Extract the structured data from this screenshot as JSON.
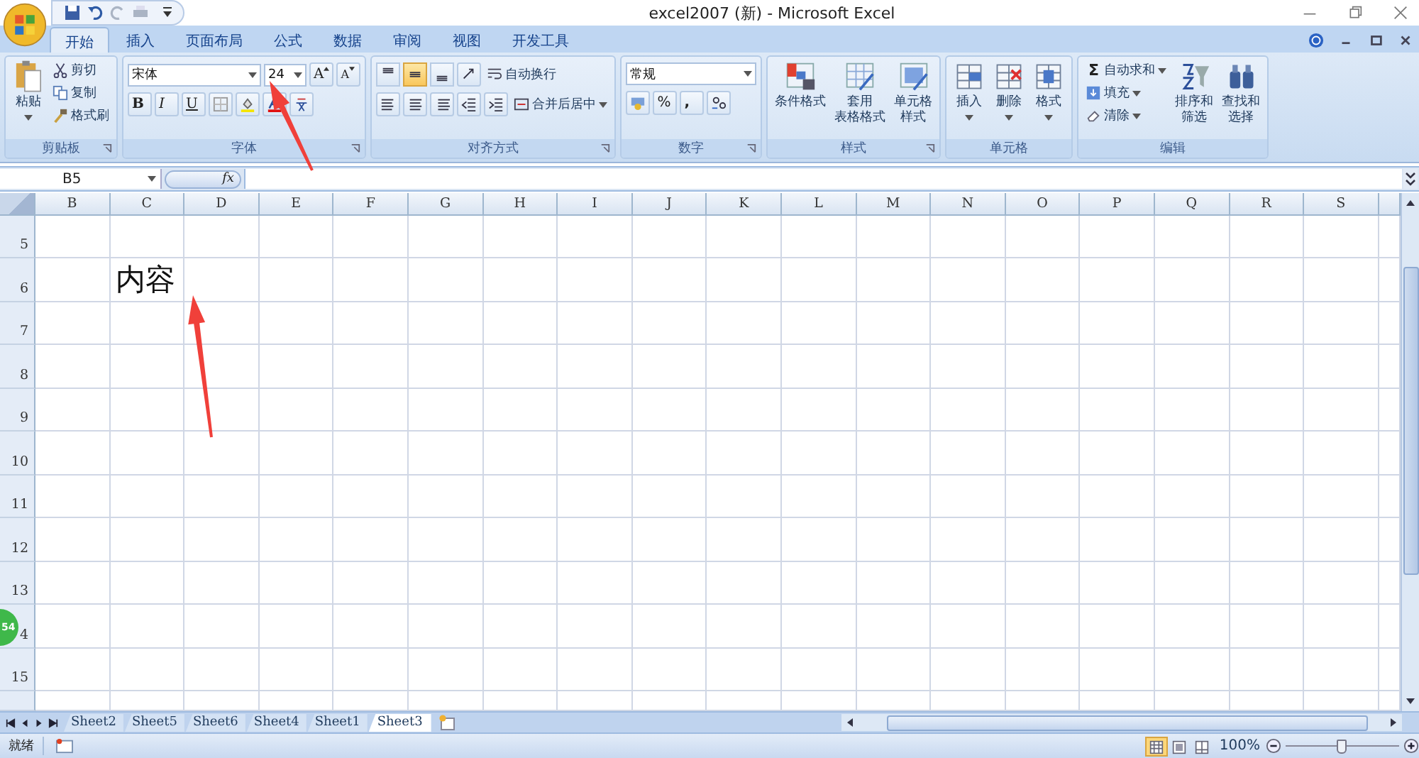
{
  "window": {
    "title": "excel2007 (新) - Microsoft Excel"
  },
  "tabs": [
    {
      "label": "开始",
      "selected": true
    },
    {
      "label": "插入",
      "selected": false
    },
    {
      "label": "页面布局",
      "selected": false
    },
    {
      "label": "公式",
      "selected": false
    },
    {
      "label": "数据",
      "selected": false
    },
    {
      "label": "审阅",
      "selected": false
    },
    {
      "label": "视图",
      "selected": false
    },
    {
      "label": "开发工具",
      "selected": false
    }
  ],
  "ribbon": {
    "clipboard": {
      "label": "剪贴板",
      "paste": "粘贴",
      "items": [
        "剪切",
        "复制",
        "格式刷"
      ]
    },
    "font": {
      "label": "字体",
      "font_name": "宋体",
      "font_size": "24",
      "grow": "A",
      "shrink": "A",
      "bold": "B",
      "italic": "I",
      "underline": "U"
    },
    "alignment": {
      "label": "对齐方式",
      "vertical": [
        {
          "selected": false
        },
        {
          "selected": true
        },
        {
          "selected": false
        }
      ],
      "wrap": "自动换行",
      "merge": "合并后居中"
    },
    "number": {
      "label": "数字",
      "format": "常规",
      "percent": "%",
      "comma": ","
    },
    "styles": {
      "label": "样式",
      "buttons": [
        {
          "lines": [
            "条件格式"
          ]
        },
        {
          "lines": [
            "套用",
            "表格格式"
          ]
        },
        {
          "lines": [
            "单元格",
            "样式"
          ]
        }
      ]
    },
    "cells": {
      "label": "单元格",
      "buttons": [
        "插入",
        "删除",
        "格式"
      ]
    },
    "editing": {
      "label": "编辑",
      "sum_symbol": "Σ",
      "items": [
        "自动求和",
        "填充",
        "清除"
      ],
      "buttons": [
        {
          "lines": [
            "排序和",
            "筛选"
          ]
        },
        {
          "lines": [
            "查找和",
            "选择"
          ]
        }
      ]
    }
  },
  "formula_bar": {
    "name_box": "B5",
    "function_label": "fx"
  },
  "columns": [
    "B",
    "C",
    "D",
    "E",
    "F",
    "G",
    "H",
    "I",
    "J",
    "K",
    "L",
    "M",
    "N",
    "O",
    "P",
    "Q",
    "R",
    "S"
  ],
  "rows": [
    {
      "label": "5"
    },
    {
      "label": "6",
      "entry": "内容"
    },
    {
      "label": "7"
    },
    {
      "label": "8"
    },
    {
      "label": "9"
    },
    {
      "label": "10"
    },
    {
      "label": "11"
    },
    {
      "label": "12"
    },
    {
      "label": "13"
    },
    {
      "label": "4"
    },
    {
      "label": "15"
    }
  ],
  "sheets": [
    {
      "label": "Sheet2",
      "selected": false
    },
    {
      "label": "Sheet5",
      "selected": false
    },
    {
      "label": "Sheet6",
      "selected": false
    },
    {
      "label": "Sheet4",
      "selected": false
    },
    {
      "label": "Sheet1",
      "selected": false
    },
    {
      "label": "Sheet3",
      "selected": true
    }
  ],
  "status_bar": {
    "status": "就绪",
    "views": [
      {
        "selected": true
      },
      {
        "selected": false
      },
      {
        "selected": false
      }
    ],
    "zoom": "100%",
    "zoom_slider": {
      "level": 0.5
    }
  },
  "floating_badge": "54",
  "annotations": [
    {
      "kind": "arrow"
    },
    {
      "kind": "arrow"
    }
  ]
}
